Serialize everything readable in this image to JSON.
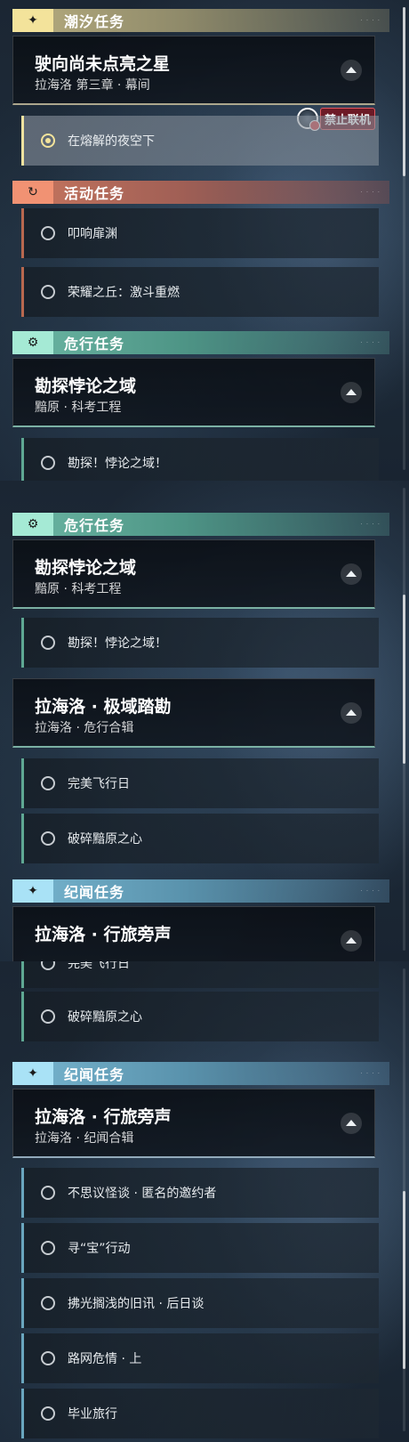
{
  "panel1": {
    "tide_header": {
      "title": "潮汐任务",
      "icon": "sparkle-icon"
    },
    "tide_card": {
      "title": "驶向尚未点亮之星",
      "subtitle": "拉海洛 第三章 · 幕间"
    },
    "disable_tag": {
      "label": "禁止联机",
      "icon": "globe-no-coop-icon"
    },
    "tide_task": {
      "label": "在熔解的夜空下",
      "state": "tracked"
    },
    "event_header": {
      "title": "活动任务",
      "icon": "refresh-icon"
    },
    "event_tasks": [
      {
        "label": "叩响扉渊"
      },
      {
        "label": "荣耀之丘：激斗重燃"
      }
    ],
    "peril_header": {
      "title": "危行任务",
      "icon": "gear-icon"
    },
    "peril_card": {
      "title": "勘探悖论之域",
      "subtitle": "黯原 · 科考工程"
    },
    "peril_task_partial": {
      "label": "勘探！悖论之域！"
    }
  },
  "panel2": {
    "peril_header": {
      "title": "危行任务",
      "icon": "gear-icon"
    },
    "peril_card": {
      "title": "勘探悖论之域",
      "subtitle": "黯原 · 科考工程"
    },
    "peril_task": {
      "label": "勘探！悖论之域！"
    },
    "peril_card2": {
      "title": "拉海洛 · 极域踏勘",
      "subtitle": "拉海洛 · 危行合辑"
    },
    "peril_tasks2": [
      {
        "label": "完美飞行日"
      },
      {
        "label": "破碎黯原之心"
      }
    ],
    "chron_header": {
      "title": "纪闻任务",
      "icon": "sparkle-icon"
    },
    "chron_card": {
      "title": "拉海洛 · 行旅旁声"
    }
  },
  "panel3": {
    "partial_task": {
      "label": "完美飞行日"
    },
    "peril_task": {
      "label": "破碎黯原之心"
    },
    "chron_header": {
      "title": "纪闻任务",
      "icon": "sparkle-icon"
    },
    "chron_card": {
      "title": "拉海洛 · 行旅旁声",
      "subtitle": "拉海洛 · 纪闻合辑"
    },
    "chron_tasks": [
      {
        "label": "不思议怪谈 · 匿名的邀约者"
      },
      {
        "label": "寻“宝”行动"
      },
      {
        "label": "拂光搁浅的旧讯 · 后日谈"
      },
      {
        "label": "路网危情 · 上"
      },
      {
        "label": "毕业旅行"
      }
    ]
  },
  "colors": {
    "tide": "#f3e39b",
    "event": "#f19273",
    "peril": "#a5ead5",
    "chron": "#a9e2f6",
    "warning": "#d7464a"
  }
}
